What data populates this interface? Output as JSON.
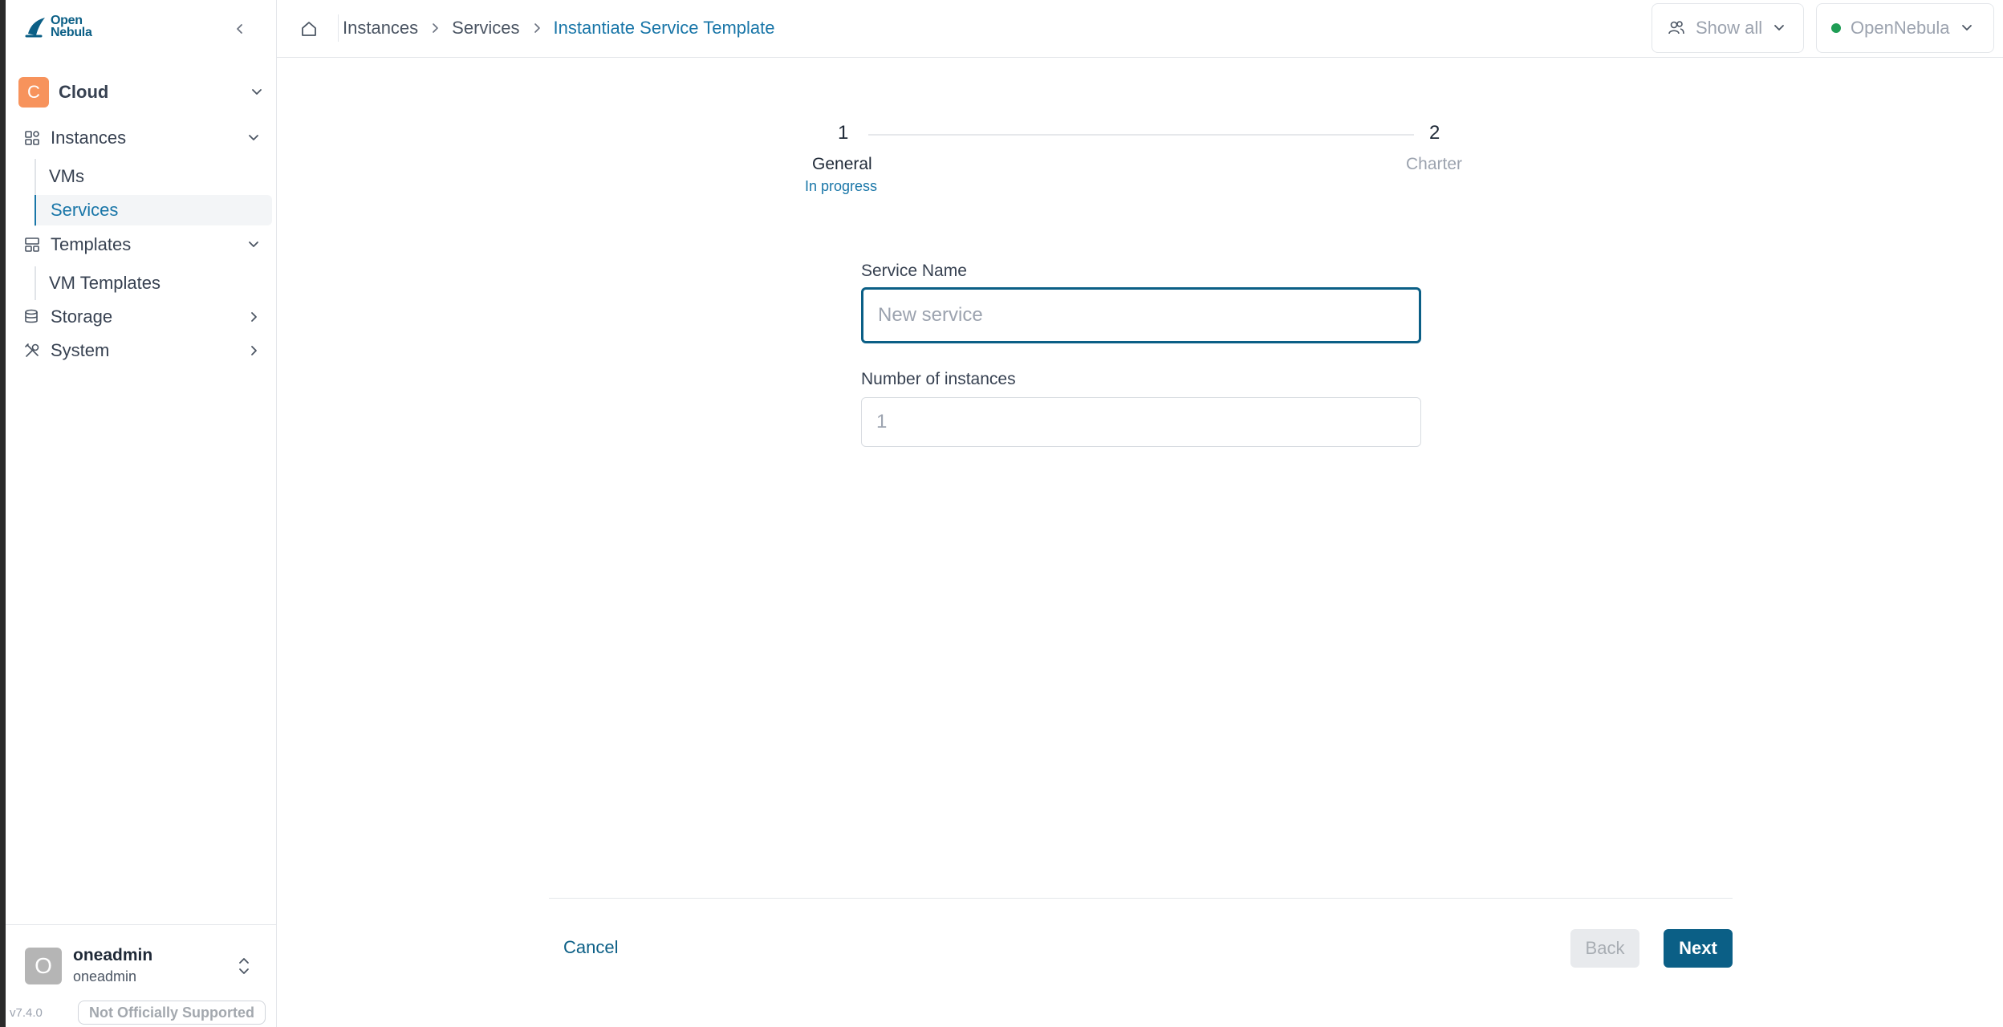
{
  "app": {
    "logo_line1": "Open",
    "logo_line2": "Nebula",
    "version": "v7.4.0",
    "support_badge": "Not Officially Supported"
  },
  "sidebar": {
    "cloud": {
      "initial": "C",
      "label": "Cloud"
    },
    "items": [
      {
        "label": "Instances",
        "icon": "instances-grid-icon",
        "expanded": true,
        "children": [
          {
            "label": "VMs",
            "active": false
          },
          {
            "label": "Services",
            "active": true
          }
        ]
      },
      {
        "label": "Templates",
        "icon": "templates-icon",
        "expanded": true,
        "children": [
          {
            "label": "VM Templates",
            "active": false
          }
        ]
      },
      {
        "label": "Storage",
        "icon": "database-icon",
        "expanded": false
      },
      {
        "label": "System",
        "icon": "tools-icon",
        "expanded": false
      }
    ]
  },
  "user": {
    "initial": "O",
    "name": "oneadmin",
    "group": "oneadmin"
  },
  "header": {
    "breadcrumb": [
      "Instances",
      "Services",
      "Instantiate Service Template"
    ],
    "group_filter": "Show all",
    "zone": "OpenNebula"
  },
  "stepper": {
    "steps": [
      {
        "number": "1",
        "title": "General",
        "status": "In progress"
      },
      {
        "number": "2",
        "title": "Charter"
      }
    ]
  },
  "form": {
    "service_name": {
      "label": "Service Name",
      "placeholder": "New service",
      "value": ""
    },
    "instances": {
      "label": "Number of instances",
      "placeholder": "1",
      "value": ""
    }
  },
  "actions": {
    "cancel": "Cancel",
    "back": "Back",
    "next": "Next"
  },
  "colors": {
    "accent": "#0b5f86",
    "link": "#1976a8",
    "cloud_avatar": "#f7935c",
    "zone_status": "#1f9d55"
  }
}
